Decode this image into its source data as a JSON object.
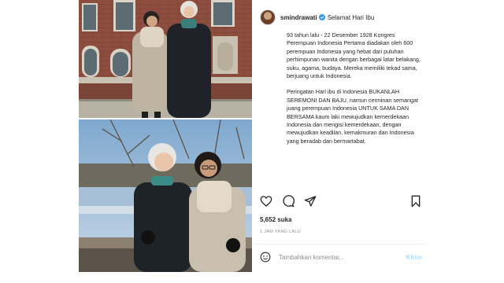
{
  "post": {
    "username": "smindrawati",
    "headline": "Selamat Hari Ibu",
    "caption": {
      "p1": "93 tahun lalu - 22 Desember 1928 Kongres Perempuan Indonesia Pertama diadakan oleh 600 perempuan Indonesia yang hebat dari puluhan perhimpunan wanita dengan berbagai latar belakang, suku, agama, budaya. Mereka memiliki tekad sama, berjuang untuk Indonesia.",
      "p2": "Peringatan Hari ibu di Indonesia BUKANLAH SEREMONI DAN BAJU, namun cerminan semangat juang perempuan Indonesia UNTUK SAMA DAN BERSAMA kaum laki mewujudkan kemerdekaan Indonesia dan mengisi kemerdekaan, dengan mewujudkan keadilan, kemakmuran dan Indonesia yang beradab dan bermartabat."
    },
    "likes": "5,652 suka",
    "time": "1 JAM YANG LALU"
  },
  "comment": {
    "placeholder": "Tambahkan komentar...",
    "post_label": "Kirim"
  },
  "icons": {
    "like": "heart-icon",
    "comment": "comment-icon",
    "share": "share-icon",
    "save": "bookmark-icon",
    "verified": "verified-badge-icon",
    "emoji": "emoji-icon"
  },
  "colors": {
    "verified": "#3897f0",
    "post_button": "#b2dffc",
    "muted": "#8e8e8e"
  }
}
